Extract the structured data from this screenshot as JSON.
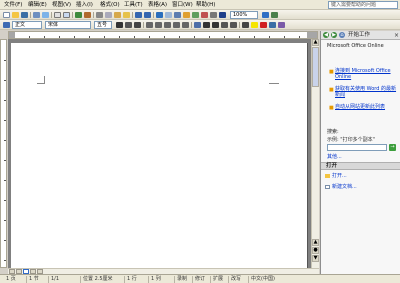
{
  "menubar": {
    "items": [
      "文件(F)",
      "编辑(E)",
      "视图(V)",
      "插入(I)",
      "格式(O)",
      "工具(T)",
      "表格(A)",
      "窗口(W)",
      "帮助(H)"
    ],
    "help_placeholder": "键入需要帮助的问题"
  },
  "toolbar": {
    "style_value": "正文",
    "font_value": "宋体",
    "size_value": "五号",
    "zoom_value": "100%"
  },
  "task_pane": {
    "title": "开始工作",
    "intro": "Microsoft Office Online",
    "links": [
      "连接到 Microsoft Office Online",
      "获取有关使用 Word 的最新新闻",
      "自动从网站更新此列表"
    ],
    "more": "其他...",
    "search_label": "搜索:",
    "search_example": "示例: \"打印多个副本\"",
    "go_label": "→",
    "open_section": "打开",
    "open_items": [
      "打开...",
      "新建文档..."
    ]
  },
  "statusbar": {
    "page": "1 页",
    "section": "1 节",
    "position": "1/1",
    "at": "位置 2.5厘米",
    "line": "1 行",
    "column": "1 列",
    "flags": [
      "录制",
      "修订",
      "扩展",
      "改写"
    ],
    "language": "中文(中国)"
  },
  "colors": {
    "accent": "#316ac5",
    "menu_bg": "#ece9d8",
    "doc_bg": "#808080",
    "link": "#0033cc"
  }
}
